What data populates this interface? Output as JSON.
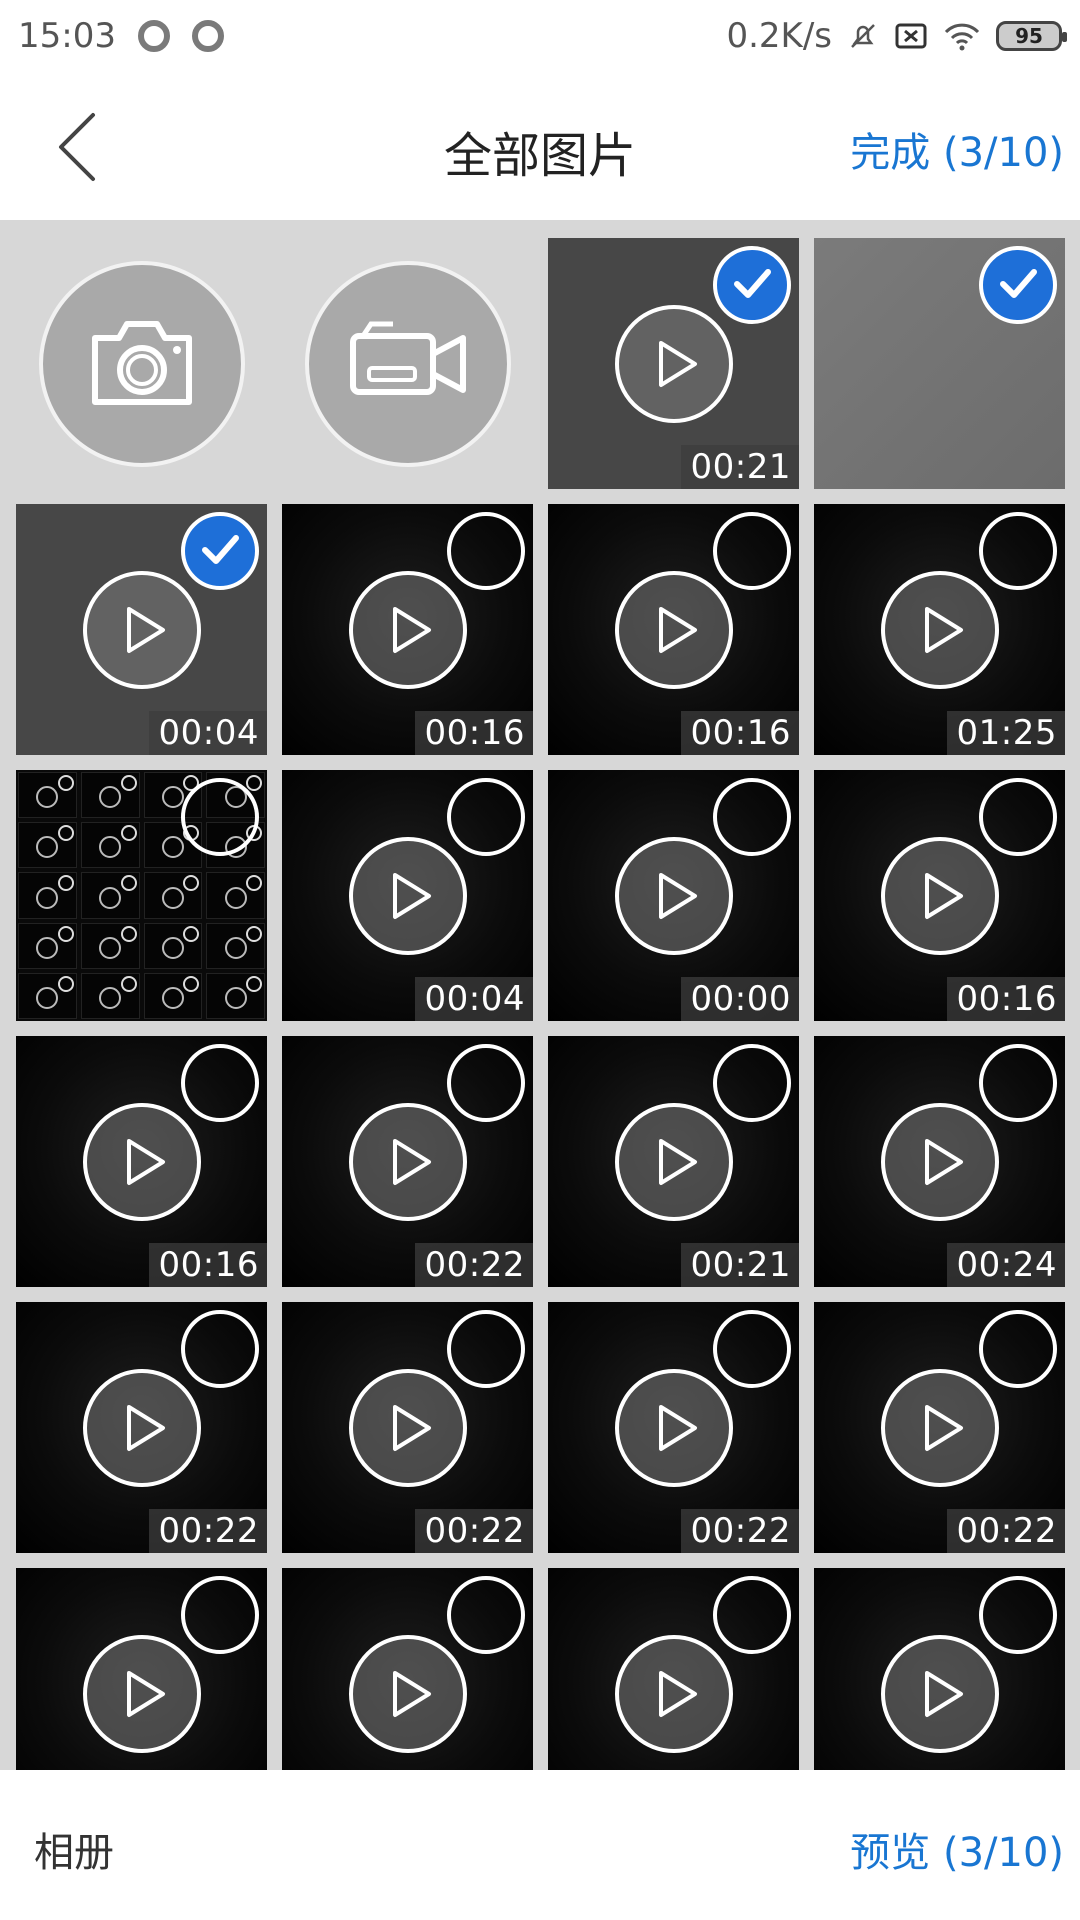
{
  "status_bar": {
    "time": "15:03",
    "network_speed": "0.2K/s",
    "battery": "95"
  },
  "header": {
    "title": "全部图片",
    "done_label": "完成 (3/10)"
  },
  "grid": {
    "items": [
      {
        "type": "camera"
      },
      {
        "type": "video-camera"
      },
      {
        "type": "video",
        "duration": "00:21",
        "checked": true,
        "style": "gray"
      },
      {
        "type": "image",
        "checked": true,
        "style": "gray-light"
      },
      {
        "type": "video",
        "duration": "00:04",
        "checked": true,
        "style": "gray"
      },
      {
        "type": "video",
        "duration": "00:16",
        "checked": false
      },
      {
        "type": "video",
        "duration": "00:16",
        "checked": false
      },
      {
        "type": "video",
        "duration": "01:25",
        "checked": false
      },
      {
        "type": "image",
        "checked": false,
        "style": "mosaic"
      },
      {
        "type": "video",
        "duration": "00:04",
        "checked": false
      },
      {
        "type": "video",
        "duration": "00:00",
        "checked": false
      },
      {
        "type": "video",
        "duration": "00:16",
        "checked": false
      },
      {
        "type": "video",
        "duration": "00:16",
        "checked": false
      },
      {
        "type": "video",
        "duration": "00:22",
        "checked": false
      },
      {
        "type": "video",
        "duration": "00:21",
        "checked": false
      },
      {
        "type": "video",
        "duration": "00:24",
        "checked": false
      },
      {
        "type": "video",
        "duration": "00:22",
        "checked": false
      },
      {
        "type": "video",
        "duration": "00:22",
        "checked": false
      },
      {
        "type": "video",
        "duration": "00:22",
        "checked": false
      },
      {
        "type": "video",
        "duration": "00:22",
        "checked": false
      },
      {
        "type": "video",
        "duration": "",
        "checked": false
      },
      {
        "type": "video",
        "duration": "",
        "checked": false
      },
      {
        "type": "video",
        "duration": "",
        "checked": false
      },
      {
        "type": "video",
        "duration": "",
        "checked": false
      }
    ]
  },
  "bottom_bar": {
    "album_label": "相册",
    "preview_label": "预览 (3/10)"
  },
  "colors": {
    "accent": "#1976d2",
    "checked": "#1e6fd8",
    "grid_background": "#d7d7d7"
  }
}
